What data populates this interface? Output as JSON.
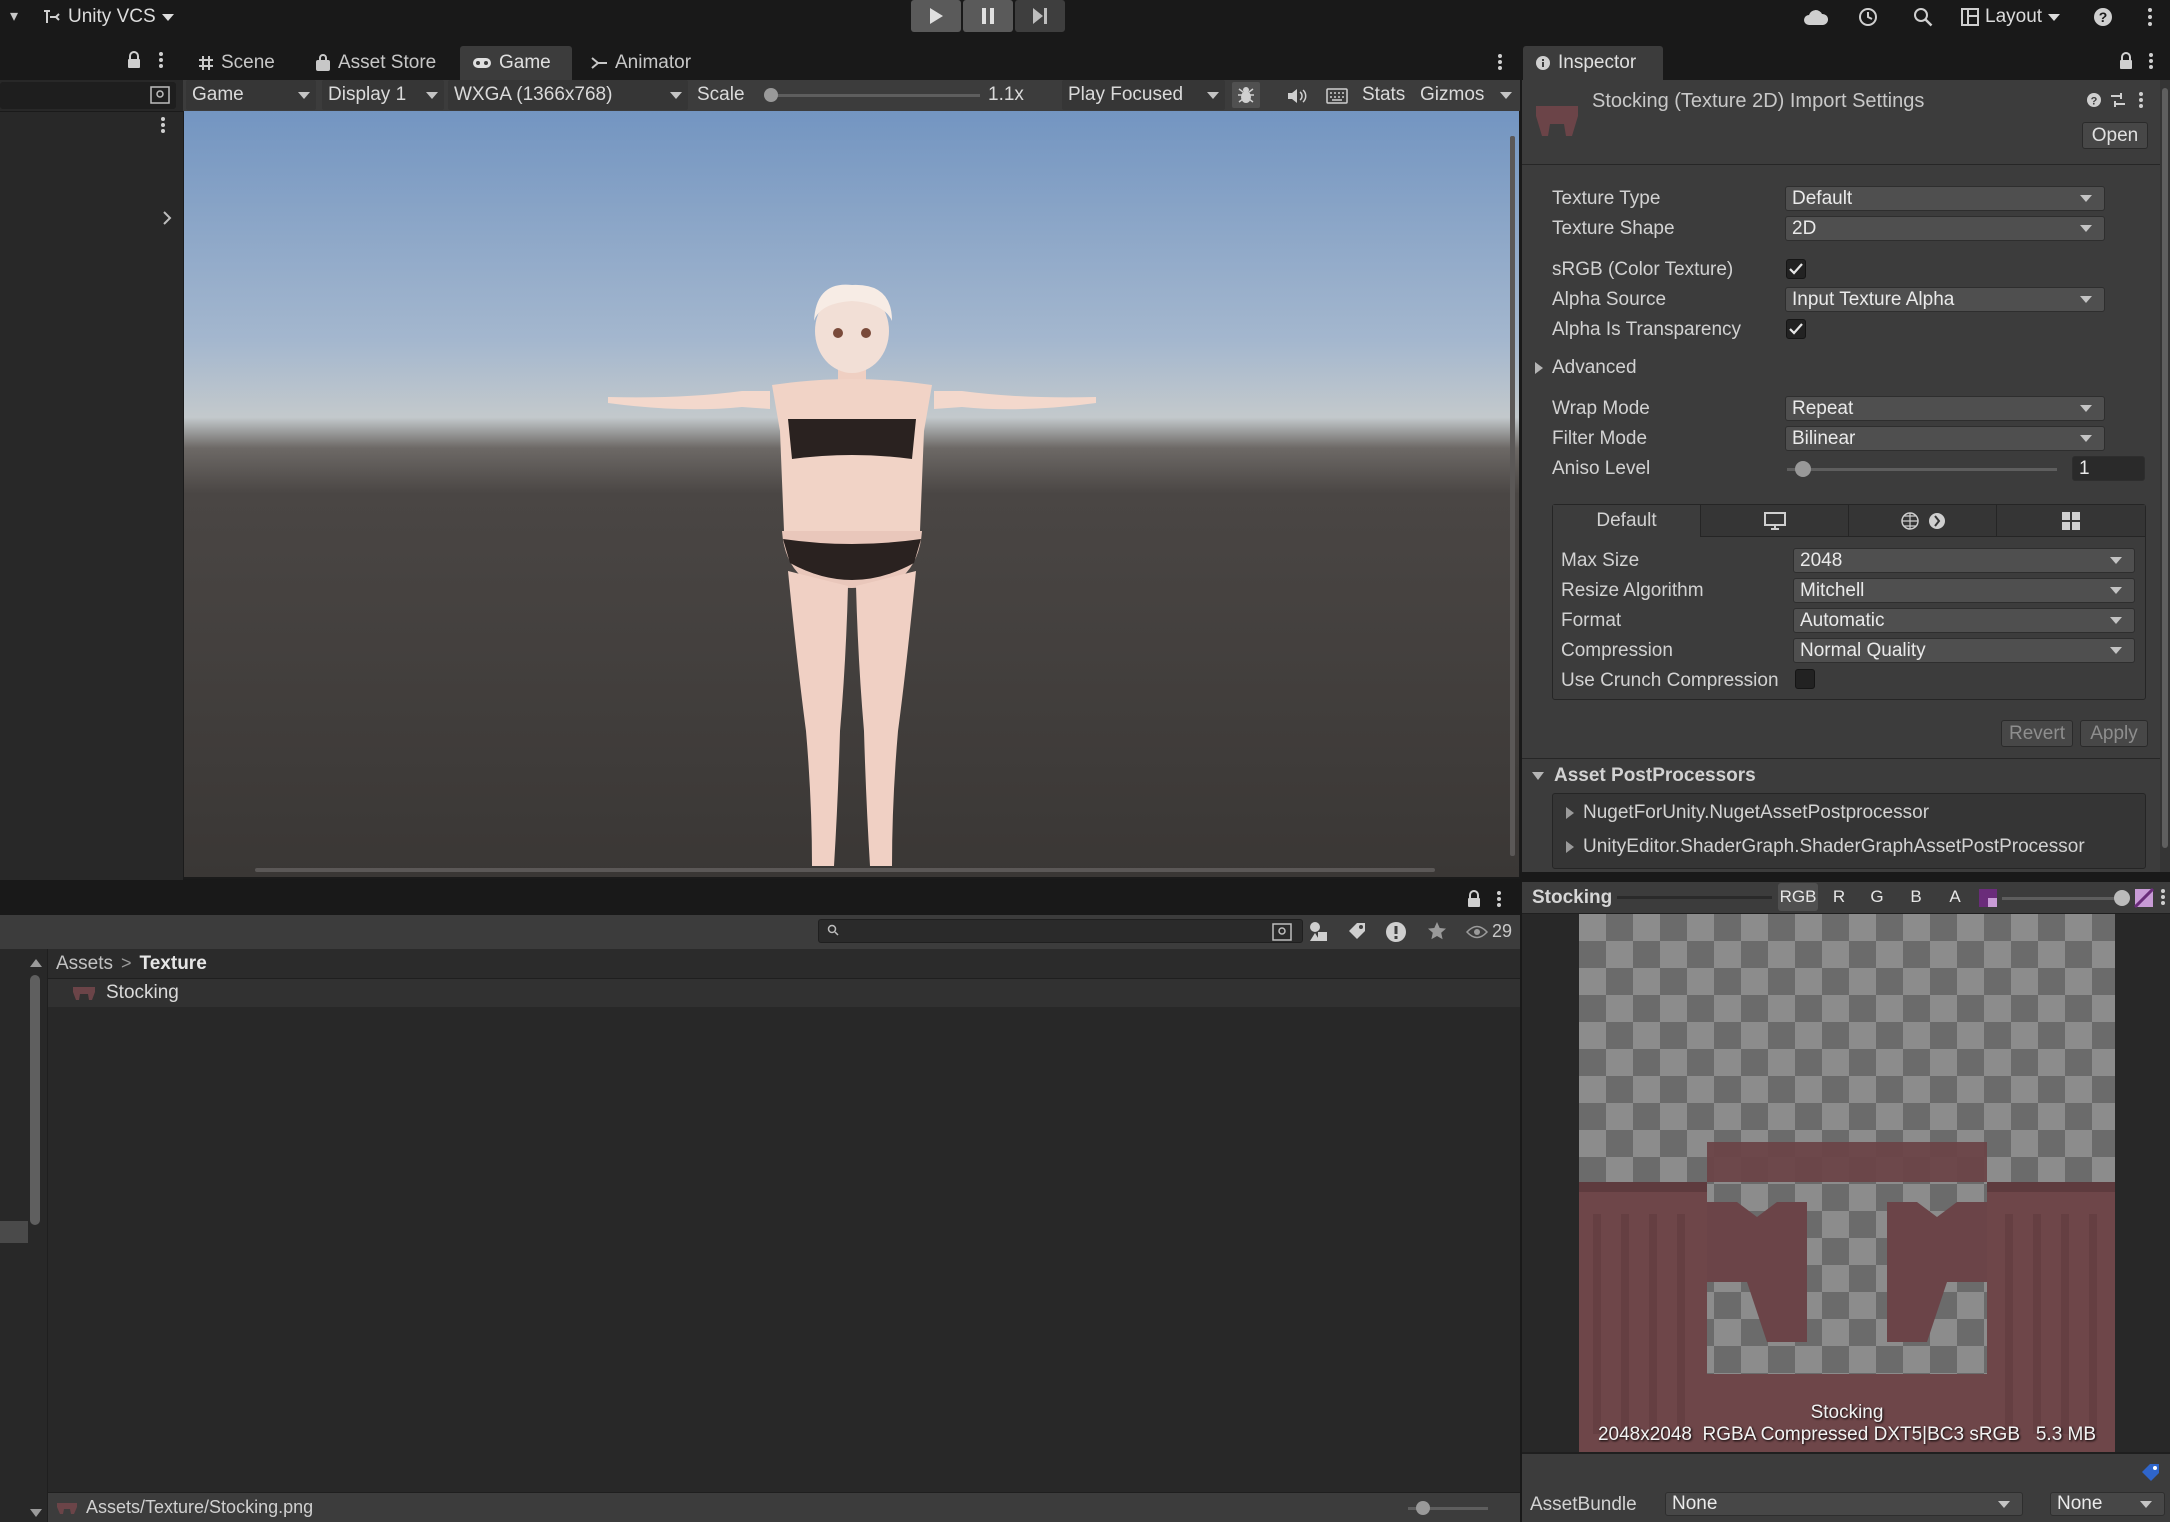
{
  "colors": {
    "accent": "#2f65ca",
    "panel": "#3c3c3c",
    "game_sky": "#7d9bc7",
    "ground": "#3b3836",
    "texture": "#6b4448"
  },
  "toolbar": {
    "menu_caret": "▾",
    "vcs_label": "Unity VCS",
    "layout_label": "Layout",
    "icons": [
      "cloud-icon",
      "history-icon",
      "search-icon",
      "layout-icon",
      "help-icon",
      "more-icon"
    ]
  },
  "tabs": {
    "scene": "Scene",
    "asset_store": "Asset Store",
    "game": "Game",
    "animator": "Animator",
    "inspector": "Inspector"
  },
  "game_toolbar": {
    "mode": "Game",
    "display": "Display 1",
    "resolution": "WXGA (1366x768)",
    "scale_label": "Scale",
    "scale_value": "1.1x",
    "scale_fraction": 0.02,
    "play_mode": "Play Focused",
    "stats": "Stats",
    "gizmos": "Gizmos"
  },
  "inspector": {
    "title": "Stocking (Texture 2D) Import Settings",
    "open_button": "Open",
    "rows": {
      "texture_type_label": "Texture Type",
      "texture_type": "Default",
      "texture_shape_label": "Texture Shape",
      "texture_shape": "2D",
      "srgb_label": "sRGB (Color Texture)",
      "srgb_checked": true,
      "alpha_source_label": "Alpha Source",
      "alpha_source": "Input Texture Alpha",
      "alpha_transparency_label": "Alpha Is Transparency",
      "alpha_transparency_checked": true,
      "advanced_label": "Advanced",
      "wrap_mode_label": "Wrap Mode",
      "wrap_mode": "Repeat",
      "filter_mode_label": "Filter Mode",
      "filter_mode": "Bilinear",
      "aniso_label": "Aniso Level",
      "aniso_value": "1",
      "aniso_fraction": 0.06
    },
    "platform_tabs": {
      "default": "Default"
    },
    "platform": {
      "max_size_label": "Max Size",
      "max_size": "2048",
      "resize_label": "Resize Algorithm",
      "resize": "Mitchell",
      "format_label": "Format",
      "format": "Automatic",
      "compression_label": "Compression",
      "compression": "Normal Quality",
      "crunch_label": "Use Crunch Compression",
      "crunch_checked": false
    },
    "revert": "Revert",
    "apply": "Apply",
    "postprocessors_title": "Asset PostProcessors",
    "postprocessors": [
      "NugetForUnity.NugetAssetPostprocessor",
      "UnityEditor.ShaderGraph.ShaderGraphAssetPostProcessor"
    ]
  },
  "project": {
    "visible_count": "29",
    "breadcrumb_root": "Assets",
    "breadcrumb_sep": ">",
    "breadcrumb_current": "Texture",
    "items": [
      "Stocking"
    ],
    "status_path": "Assets/Texture/Stocking.png"
  },
  "preview": {
    "title": "Stocking",
    "channels": [
      "RGB",
      "R",
      "G",
      "B",
      "A"
    ],
    "image_name": "Stocking",
    "image_info": "2048x2048  RGBA Compressed DXT5|BC3 sRGB   5.3 MB",
    "assetbundle_label": "AssetBundle",
    "assetbundle_name": "None",
    "assetbundle_variant": "None"
  }
}
